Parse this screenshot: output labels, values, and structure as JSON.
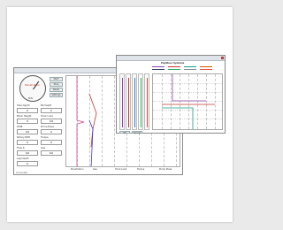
{
  "main_window": {
    "title": "",
    "gauge": {
      "title": "Penetration",
      "unit": "ft/hr"
    },
    "fields": [
      {
        "label": "Hole Depth",
        "value": "0"
      },
      {
        "label": "Bit Depth",
        "value": "0"
      },
      {
        "label": "Block Height",
        "value": "0"
      },
      {
        "label": "Hook Load",
        "value": "0.0"
      },
      {
        "label": "WOB",
        "value": "0.0"
      },
      {
        "label": "Pump Press",
        "value": "0"
      },
      {
        "label": "Rotary RPM",
        "value": "0"
      },
      {
        "label": "Torque",
        "value": "0"
      },
      {
        "label": "Flow In",
        "value": "0.0"
      },
      {
        "label": "Gas",
        "value": "0.0"
      },
      {
        "label": "Lag Depth",
        "value": "0"
      }
    ],
    "buttons": [
      "Start",
      "Stop",
      "Reset",
      "Settings"
    ],
    "plot_footer_labels": [
      "Penetration",
      "Gas",
      "Hook Load",
      "Torque",
      "Pump Press"
    ],
    "status": "Connected",
    "colors": {
      "rop": "#d44a8a",
      "gas": "#c0392b",
      "depth": "#3b3bd4"
    }
  },
  "dialog_window": {
    "title": "",
    "header": "PaySteer Systems",
    "legend_colors": [
      "#8e44ad",
      "#c0392b",
      "#16a085",
      "#d35400",
      "#2c3e50",
      "#27ae60",
      "#7f8c8d",
      "#e74c3c"
    ],
    "track_colors": [
      "#8e44ad",
      "#c0392b",
      "#2980b9",
      "#27ae60",
      "#e74c3c"
    ],
    "footer_buttons": [
      "OK",
      "Cancel"
    ]
  }
}
